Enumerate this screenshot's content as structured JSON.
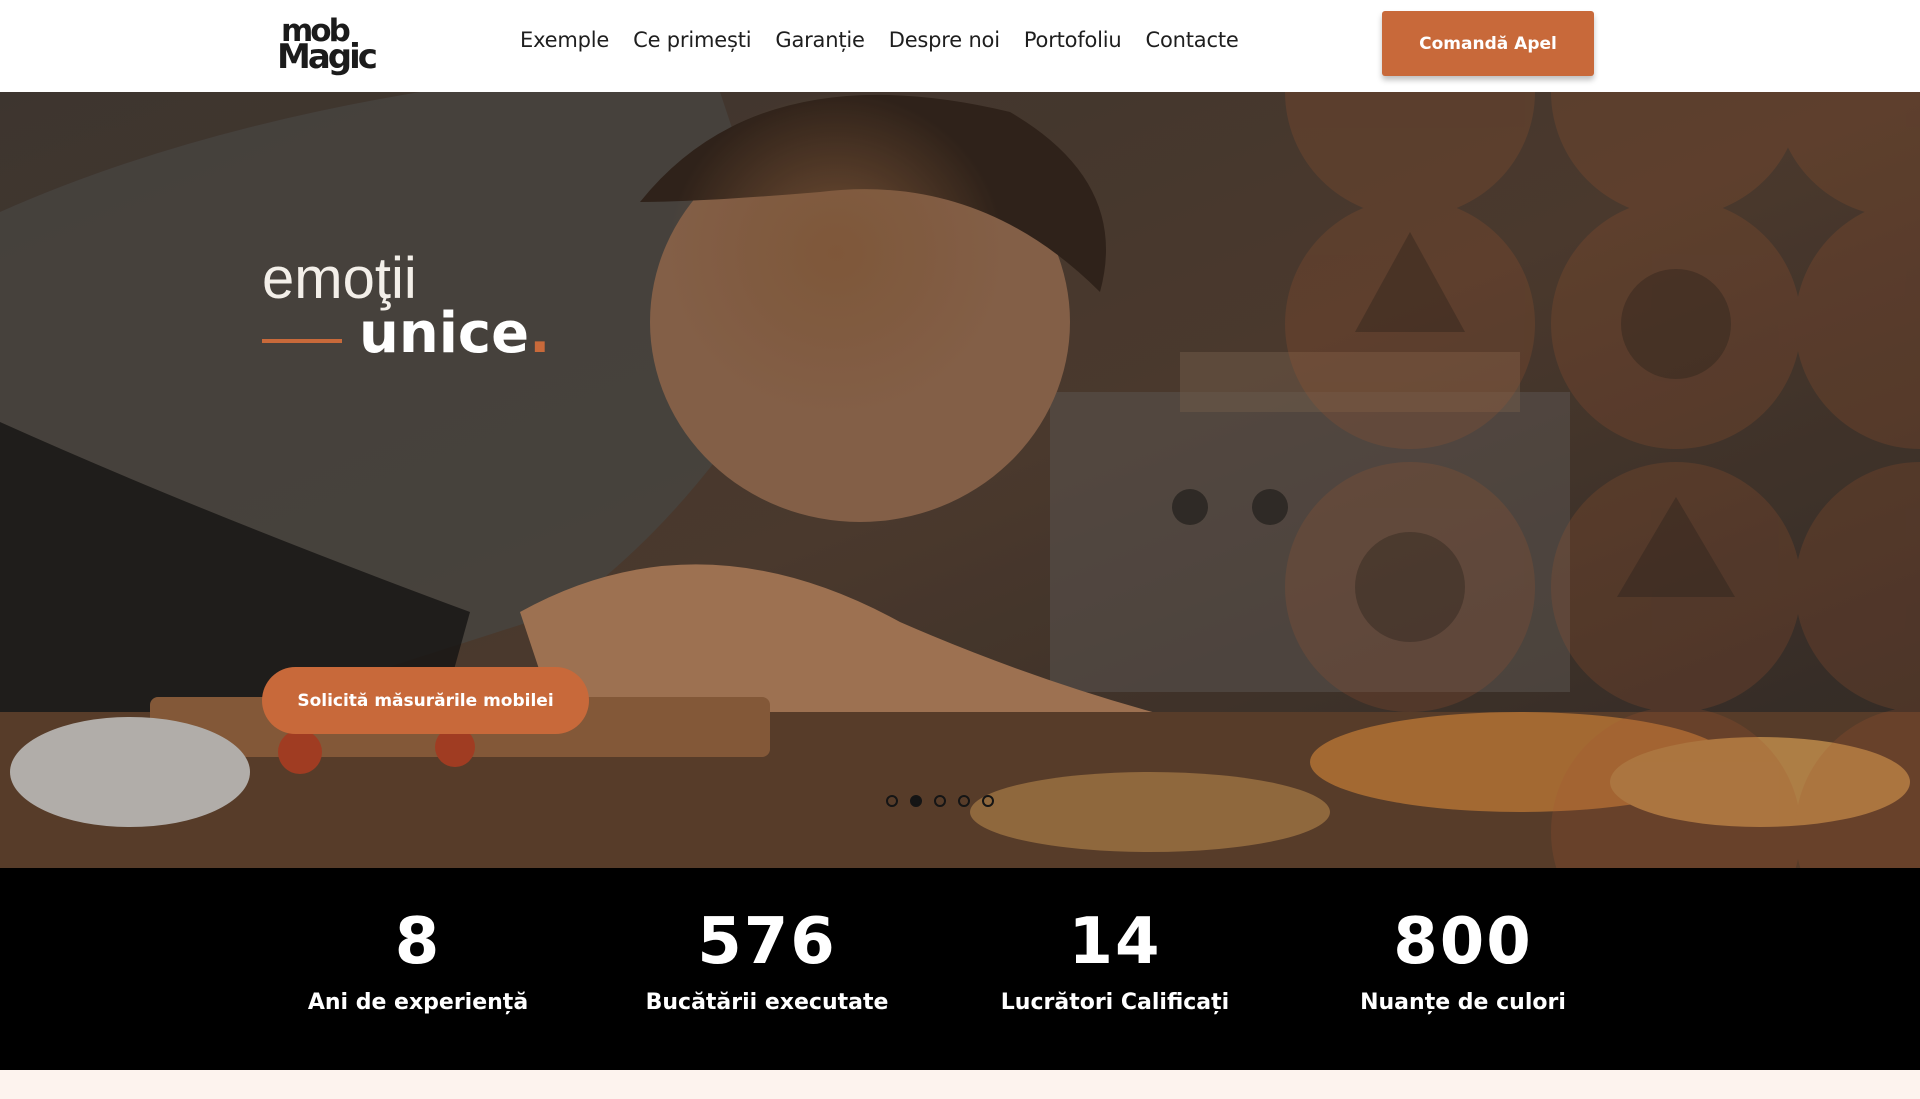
{
  "brand": {
    "logo_line1": "mob",
    "logo_line2": "Magic"
  },
  "nav": {
    "items": [
      {
        "label": "Exemple"
      },
      {
        "label": "Ce primești"
      },
      {
        "label": "Garanție"
      },
      {
        "label": "Despre noi"
      },
      {
        "label": "Portofoliu"
      },
      {
        "label": "Contacte"
      }
    ],
    "cta_label": "Comandă Apel"
  },
  "hero": {
    "tagline_line1": "emoţii",
    "tagline_line2": "unice",
    "tagline_dot": ".",
    "button_label": "Solicită măsurările mobilei",
    "slider": {
      "slide_count": 5,
      "active_index": 1
    }
  },
  "stats": [
    {
      "value": "8",
      "label": "Ani de experiență"
    },
    {
      "value": "576",
      "label": "Bucătării executate"
    },
    {
      "value": "14",
      "label": "Lucrători Calificați"
    },
    {
      "value": "800",
      "label": "Nuanțe de culori"
    }
  ],
  "colors": {
    "accent": "#c8693a",
    "header_bg": "#ffffff",
    "stats_bg": "#000000",
    "page_bg": "#fdf3ee"
  }
}
